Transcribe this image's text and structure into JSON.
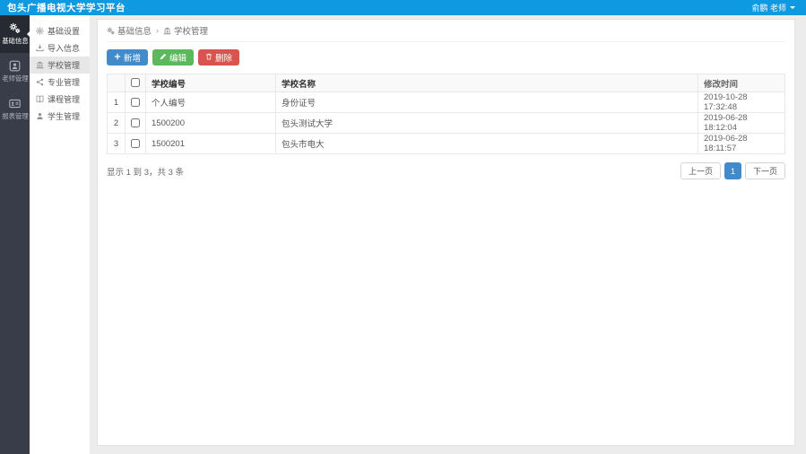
{
  "topbar": {
    "title": "包头广播电视大学学习平台",
    "user_name": "俞鹏 老师"
  },
  "sidebar": {
    "items": [
      {
        "label": "基础信息",
        "icon": "cogs-icon",
        "active": true
      },
      {
        "label": "老师管理",
        "icon": "teacher-icon",
        "active": false
      },
      {
        "label": "报表管理",
        "icon": "report-icon",
        "active": false
      }
    ]
  },
  "submenu": {
    "items": [
      {
        "label": "基础设置",
        "icon": "gear-icon",
        "active": false
      },
      {
        "label": "导入信息",
        "icon": "import-icon",
        "active": false
      },
      {
        "label": "学校管理",
        "icon": "school-icon",
        "active": true
      },
      {
        "label": "专业管理",
        "icon": "major-icon",
        "active": false
      },
      {
        "label": "课程管理",
        "icon": "course-icon",
        "active": false
      },
      {
        "label": "学生管理",
        "icon": "student-icon",
        "active": false
      }
    ]
  },
  "breadcrumb": {
    "first": "基础信息",
    "separator": "›",
    "second": "学校管理"
  },
  "toolbar": {
    "add_label": "新增",
    "edit_label": "编辑",
    "delete_label": "删除"
  },
  "table": {
    "headers": {
      "code": "学校编号",
      "name": "学校名称",
      "time": "修改时间"
    },
    "rows": [
      {
        "index": "1",
        "code": "个人编号",
        "name": "身份证号",
        "time": "2019-10-28 17:32:48"
      },
      {
        "index": "2",
        "code": "1500200",
        "name": "包头测试大学",
        "time": "2019-06-28 18:12:04"
      },
      {
        "index": "3",
        "code": "1500201",
        "name": "包头市电大",
        "time": "2019-06-28 18:11:57"
      }
    ]
  },
  "pagination": {
    "summary": "显示 1 到 3，共 3 条",
    "prev_label": "上一页",
    "current_page": "1",
    "next_label": "下一页"
  },
  "colors": {
    "topbar_blue": "#0f99e0",
    "sidebar_dark": "#393d49",
    "primary_blue": "#428bca",
    "success_green": "#5cb85c",
    "danger_red": "#d9534f"
  }
}
